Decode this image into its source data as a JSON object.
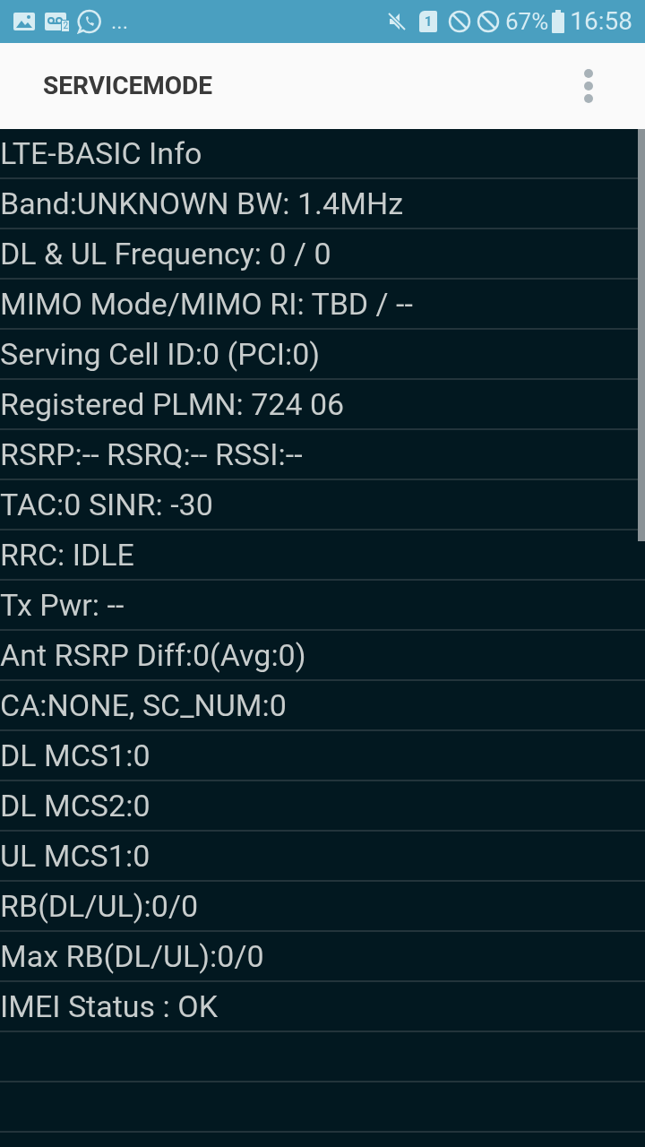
{
  "status_bar": {
    "voicemail_badge": "2",
    "overflow": "...",
    "sim_label": "1",
    "battery": "67%",
    "time": "16:58"
  },
  "app_bar": {
    "title": "SERVICEMODE"
  },
  "info_lines": [
    "LTE-BASIC Info",
    "Band:UNKNOWN BW: 1.4MHz",
    "DL & UL Frequency: 0 / 0",
    "MIMO Mode/MIMO RI: TBD / --",
    "Serving Cell ID:0 (PCI:0)",
    "Registered PLMN: 724 06",
    "RSRP:-- RSRQ:-- RSSI:--",
    "TAC:0 SINR: -30",
    "RRC: IDLE",
    "Tx Pwr: --",
    "Ant RSRP Diff:0(Avg:0)",
    "CA:NONE, SC_NUM:0",
    "DL MCS1:0",
    "DL MCS2:0",
    "UL MCS1:0",
    "RB(DL/UL):0/0",
    "Max RB(DL/UL):0/0",
    "IMEI Status : OK"
  ]
}
